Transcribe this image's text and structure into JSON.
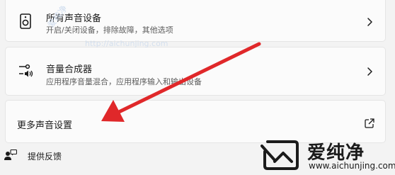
{
  "devices_card": {
    "title": "所有声音设备",
    "description": "开启/关闭设备，排除故障，其他选项",
    "icon": "speaker-icon"
  },
  "mixer_card": {
    "title": "音量合成器",
    "description": "应用程序音量混合，应用程序输入和输出设备",
    "icon": "mixer-icon"
  },
  "more_card": {
    "title": "更多声音设置",
    "icon": "open-external-icon"
  },
  "feedback": {
    "label": "提供反馈",
    "icon": "feedback-icon"
  },
  "watermark": {
    "diagonal": "爱纯净",
    "text": "http://aichunjing.com"
  },
  "logo": {
    "title": "爱纯净",
    "url": "www.aichunjing.com"
  },
  "colors": {
    "arrow": "#e0282a",
    "card_bg": "#fbfbfb",
    "page_bg": "#f3f3f3"
  }
}
